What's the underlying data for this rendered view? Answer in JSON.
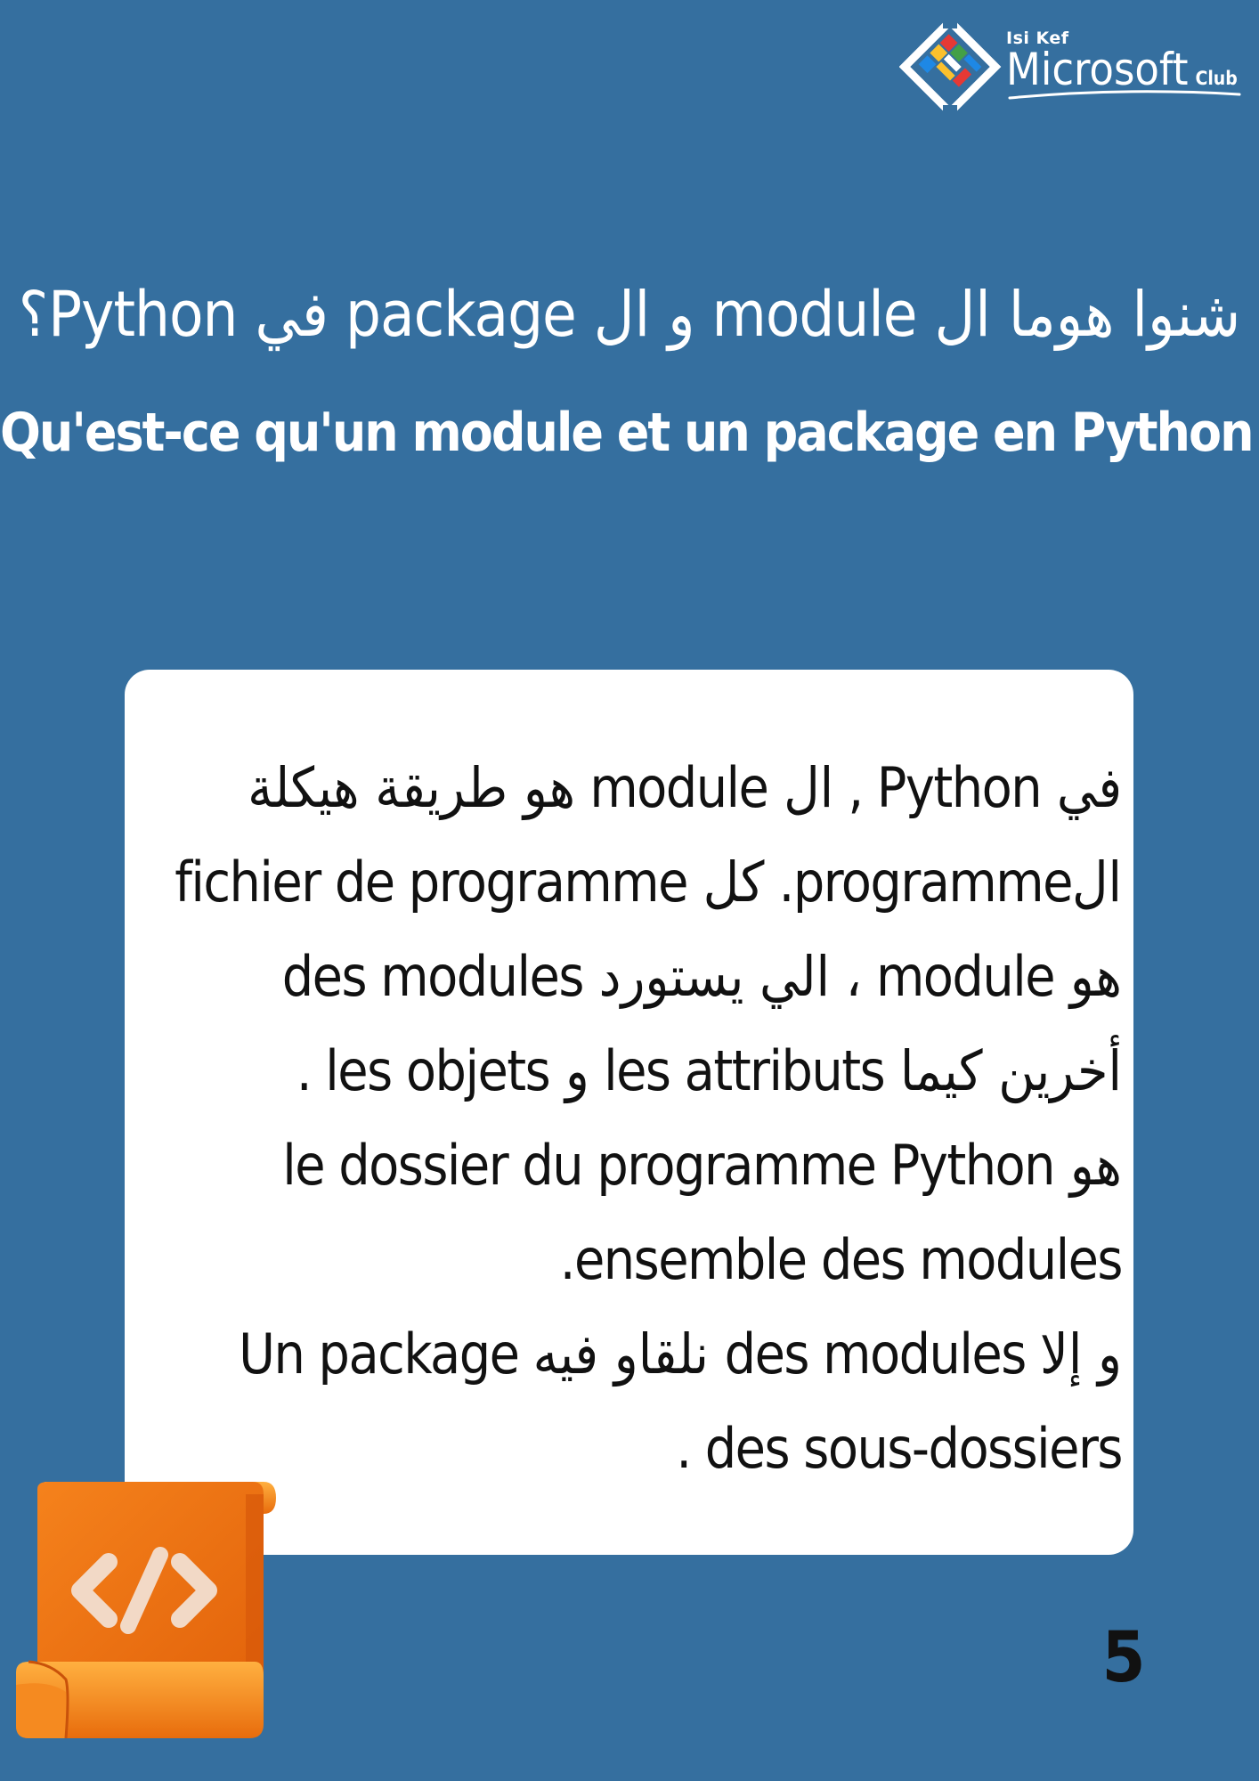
{
  "logo": {
    "small_text": "Isi Kef",
    "main_text": "Microsoft",
    "suffix_text": "Club"
  },
  "title_arabic": "شنوا هوما ال module و ال package في Python؟",
  "title_french": "Qu'est-ce qu'un module et un package en Python ?",
  "card": {
    "lines": [
      "في Python , ال module هو طريقة هيكلة",
      "الprogramme.  كل fichier de programme",
      "هو module ، الي يستورد des modules",
      "أخرين كيما les attributs و les objets .",
      "هو le dossier du programme Python",
      ".ensemble des modules",
      "Un package نلقاو فيه des modules و إلا",
      ". des sous-dossiers"
    ]
  },
  "page_number": "5",
  "icons": {
    "logo": "microsoft-club-logo-icon",
    "scroll": "code-scroll-icon"
  },
  "colors": {
    "background": "#356f9f",
    "card": "#ffffff",
    "scroll_orange": "#f07a12"
  }
}
